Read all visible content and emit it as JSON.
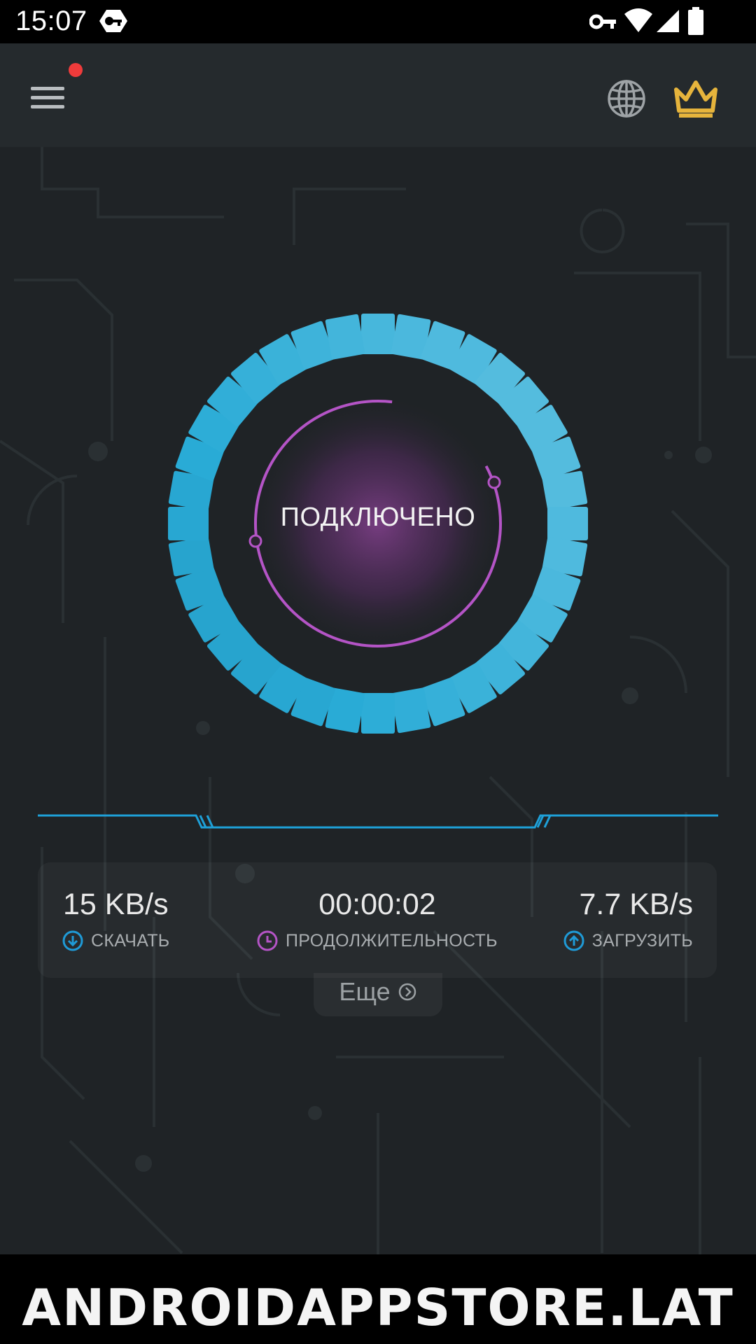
{
  "status_bar": {
    "time": "15:07",
    "icons": [
      "vpn-badge-icon",
      "key-icon",
      "wifi-icon",
      "signal-icon",
      "battery-icon"
    ]
  },
  "app_bar": {
    "icons": [
      "menu-icon",
      "globe-icon",
      "crown-icon"
    ],
    "notification_dot_color": "#ef3b3b",
    "crown_color": "#e6b43c"
  },
  "connection": {
    "status": "ПОДКЛЮЧЕНО",
    "segment_color": "#2aa8d8",
    "ring_color": "#b454c6"
  },
  "stats": {
    "download": {
      "value": "15 KB/s",
      "label": "СКАЧАТЬ"
    },
    "duration": {
      "value": "00:00:02",
      "label": "ПРОДОЛЖИТЕЛЬНОСТЬ"
    },
    "upload": {
      "value": "7.7 KB/s",
      "label": "ЗАГРУЗИТЬ"
    }
  },
  "more": {
    "label": "Еще"
  },
  "watermark": "ANDROIDAPPSTORE.LAT"
}
